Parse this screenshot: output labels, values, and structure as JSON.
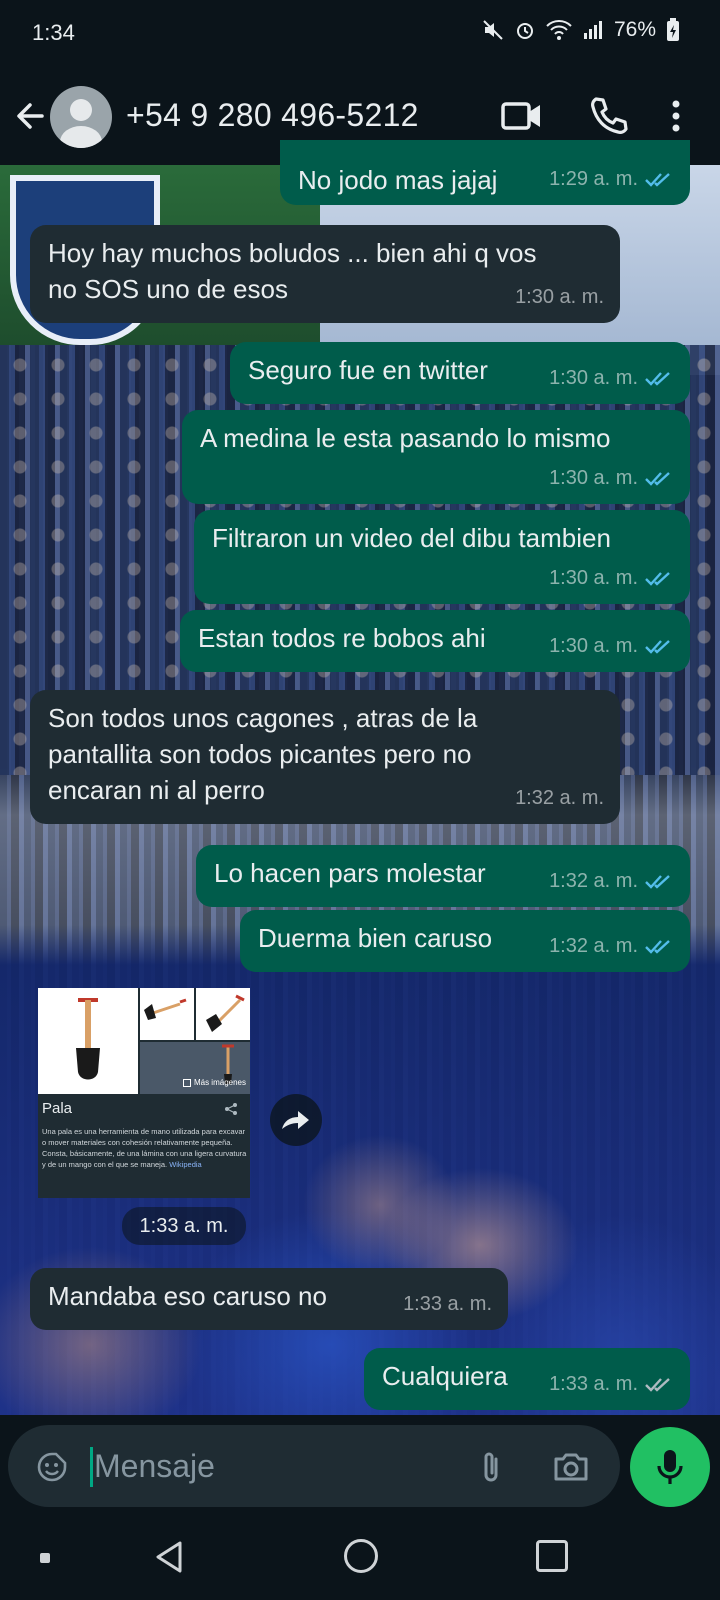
{
  "status_bar": {
    "time": "1:34",
    "battery": "76%",
    "icons": [
      "mute-icon",
      "alarm-icon",
      "wifi-icon",
      "signal-icon",
      "battery-icon"
    ]
  },
  "header": {
    "contact_name": "+54 9 280 496-5212",
    "icons": [
      "back-arrow-icon",
      "avatar-icon",
      "video-call-icon",
      "phone-icon",
      "more-vert-icon"
    ]
  },
  "messages": [
    {
      "direction": "out",
      "text": "No jodo mas jajaj",
      "time": "1:29 a. m.",
      "read": true
    },
    {
      "direction": "in",
      "text": "Hoy hay muchos boludos ... bien ahi q vos\nno SOS uno de esos",
      "time": "1:30 a. m."
    },
    {
      "direction": "out",
      "text": "Seguro fue en twitter",
      "time": "1:30 a. m.",
      "read": true
    },
    {
      "direction": "out",
      "text": "A medina le esta pasando lo mismo",
      "time": "1:30 a. m.",
      "read": true
    },
    {
      "direction": "out",
      "text": "Filtraron un video del dibu tambien",
      "time": "1:30 a. m.",
      "read": true
    },
    {
      "direction": "out",
      "text": "Estan todos re bobos ahi",
      "time": "1:30 a. m.",
      "read": true
    },
    {
      "direction": "in",
      "text": "Son todos unos cagones , atras de la\npantallita son todos picantes pero no\nencaran ni al perro",
      "time": "1:32 a. m."
    },
    {
      "direction": "out",
      "text": "Lo hacen pars molestar",
      "time": "1:32 a. m.",
      "read": true
    },
    {
      "direction": "out",
      "text": "Duerma bien caruso",
      "time": "1:32 a. m.",
      "read": true
    },
    {
      "direction": "in",
      "text": "Mandaba eso caruso no",
      "time": "1:33 a. m."
    },
    {
      "direction": "out",
      "text": "Cualquiera",
      "time": "1:33 a. m.",
      "read": false
    }
  ],
  "image_message": {
    "card_title": "Pala",
    "more_images": "Más imágenes",
    "description": "Una pala es una herramienta de mano utilizada para excavar o mover materiales con cohesión relativamente pequeña. Consta, básicamente, de una lámina con una ligera curvatura y de un mango con el que se maneja.",
    "source": "Wikipedia",
    "time": "1:33 a. m.",
    "icons": [
      "share-icon",
      "forward-icon"
    ]
  },
  "composer": {
    "placeholder": "Mensaje",
    "icons": [
      "emoji-sticker-icon",
      "attach-icon",
      "camera-icon",
      "mic-icon"
    ]
  },
  "colors": {
    "outgoing_bubble": "#005c4b",
    "incoming_bubble": "#1f2c33",
    "read_ticks": "#53bdeb",
    "mic_button": "#21c063",
    "background": "#0b141a"
  }
}
